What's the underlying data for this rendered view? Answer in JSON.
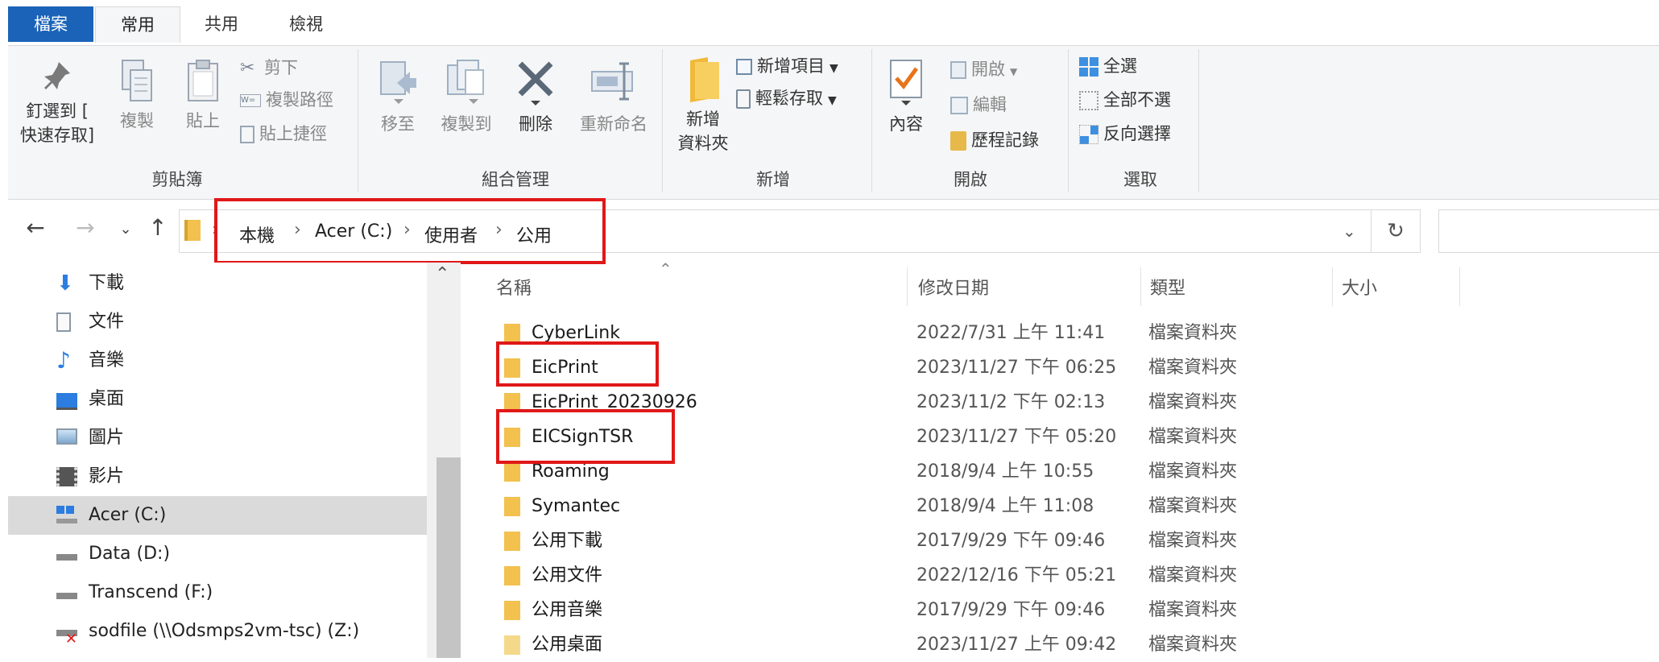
{
  "tabs": [
    "檔案",
    "常用",
    "共用",
    "檢視"
  ],
  "ribbon": {
    "clipboard": {
      "group_label": "剪貼簿",
      "pin_label_1": "釘選到 [",
      "pin_label_2": "快速存取]",
      "copy_label": "複製",
      "paste_label": "貼上",
      "cut_label": "剪下",
      "copy_path_label": "複製路徑",
      "paste_shortcut_label": "貼上捷徑"
    },
    "organize": {
      "group_label": "組合管理",
      "move_to_label": "移至",
      "copy_to_label": "複製到",
      "delete_label": "刪除",
      "rename_label": "重新命名"
    },
    "new": {
      "group_label": "新增",
      "new_folder_label_1": "新增",
      "new_folder_label_2": "資料夾",
      "new_item_label": "新增項目",
      "easy_access_label": "輕鬆存取"
    },
    "open": {
      "group_label": "開啟",
      "properties_label": "內容",
      "open_label": "開啟",
      "edit_label": "編輯",
      "history_label": "歷程記錄"
    },
    "select": {
      "group_label": "選取",
      "select_all_label": "全選",
      "select_none_label": "全部不選",
      "invert_label": "反向選擇"
    }
  },
  "breadcrumb": [
    "本機",
    "Acer (C:)",
    "使用者",
    "公用"
  ],
  "sidebar": {
    "items": [
      {
        "label": "下載",
        "icon": "download-icon"
      },
      {
        "label": "文件",
        "icon": "documents-icon"
      },
      {
        "label": "音樂",
        "icon": "music-icon"
      },
      {
        "label": "桌面",
        "icon": "desktop-icon"
      },
      {
        "label": "圖片",
        "icon": "pictures-icon"
      },
      {
        "label": "影片",
        "icon": "videos-icon"
      },
      {
        "label": "Acer (C:)",
        "icon": "windows-drive-icon",
        "selected": true
      },
      {
        "label": "Data (D:)",
        "icon": "drive-icon"
      },
      {
        "label": "Transcend (F:)",
        "icon": "drive-icon"
      },
      {
        "label": "sodfile (\\\\Odsmps2vm-tsc) (Z:)",
        "icon": "network-drive-disconnected-icon"
      }
    ]
  },
  "columns": {
    "name": "名稱",
    "modified": "修改日期",
    "type": "類型",
    "size": "大小"
  },
  "files": [
    {
      "name": "CyberLink",
      "modified": "2022/7/31 上午 11:41",
      "type": "檔案資料夾"
    },
    {
      "name": "EicPrint",
      "modified": "2023/11/27 下午 06:25",
      "type": "檔案資料夾"
    },
    {
      "name": "EicPrint_20230926",
      "modified": "2023/11/2 下午 02:13",
      "type": "檔案資料夾"
    },
    {
      "name": "EICSignTSR",
      "modified": "2023/11/27 下午 05:20",
      "type": "檔案資料夾"
    },
    {
      "name": "Roaming",
      "modified": "2018/9/4 上午 10:55",
      "type": "檔案資料夾"
    },
    {
      "name": "Symantec",
      "modified": "2018/9/4 上午 11:08",
      "type": "檔案資料夾"
    },
    {
      "name": "公用下載",
      "modified": "2017/9/29 下午 09:46",
      "type": "檔案資料夾"
    },
    {
      "name": "公用文件",
      "modified": "2022/12/16 下午 05:21",
      "type": "檔案資料夾"
    },
    {
      "name": "公用音樂",
      "modified": "2017/9/29 下午 09:46",
      "type": "檔案資料夾"
    },
    {
      "name": "公用桌面",
      "modified": "2023/11/27 上午 09:42",
      "type": "檔案資料夾"
    }
  ],
  "colors": {
    "accent": "#1a63b8",
    "highlight_box": "#e01818",
    "folder": "#f2c14e"
  }
}
